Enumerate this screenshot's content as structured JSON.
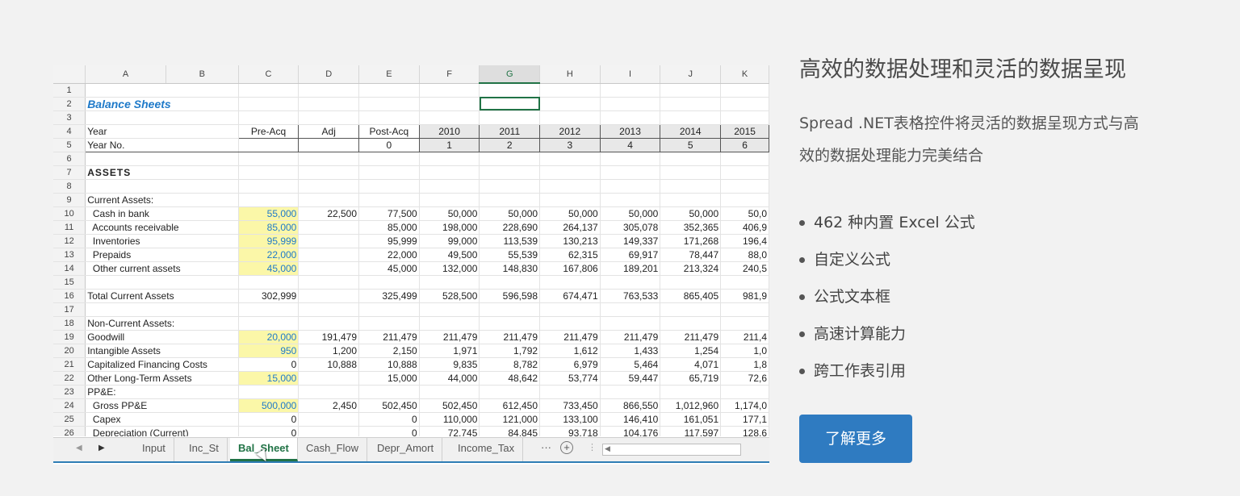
{
  "panel": {
    "title": "高效的数据处理和灵活的数据呈现",
    "description": "Spread .NET表格控件将灵活的数据呈现方式与高效的数据处理能力完美结合",
    "features": [
      "462 种内置 Excel 公式",
      "自定义公式",
      "公式文本框",
      "高速计算能力",
      "跨工作表引用"
    ],
    "button_label": "了解更多"
  },
  "sheet": {
    "columns": [
      "A",
      "B",
      "C",
      "D",
      "E",
      "F",
      "G",
      "H",
      "I",
      "J",
      "K"
    ],
    "selected_column": "G",
    "rows": [
      {
        "n": "1",
        "label": "",
        "c": "",
        "d": "",
        "e": "",
        "f": "",
        "g": "",
        "h": "",
        "i": "",
        "j": "",
        "k": ""
      },
      {
        "n": "2",
        "label": "Balance Sheets",
        "c": "",
        "d": "",
        "e": "",
        "f": "",
        "g": "",
        "h": "",
        "i": "",
        "j": "",
        "k": ""
      },
      {
        "n": "3",
        "label": "",
        "c": "",
        "d": "",
        "e": "",
        "f": "",
        "g": "",
        "h": "",
        "i": "",
        "j": "",
        "k": ""
      },
      {
        "n": "4",
        "label": "Year",
        "c": "Pre-Acq",
        "d": "Adj",
        "e": "Post-Acq",
        "f": "2010",
        "g": "2011",
        "h": "2012",
        "i": "2013",
        "j": "2014",
        "k": "2015"
      },
      {
        "n": "5",
        "label": "Year No.",
        "c": "",
        "d": "",
        "e": "0",
        "f": "1",
        "g": "2",
        "h": "3",
        "i": "4",
        "j": "5",
        "k": "6"
      },
      {
        "n": "6",
        "label": "",
        "c": "",
        "d": "",
        "e": "",
        "f": "",
        "g": "",
        "h": "",
        "i": "",
        "j": "",
        "k": ""
      },
      {
        "n": "7",
        "label": "ASSETS",
        "c": "",
        "d": "",
        "e": "",
        "f": "",
        "g": "",
        "h": "",
        "i": "",
        "j": "",
        "k": ""
      },
      {
        "n": "8",
        "label": "",
        "c": "",
        "d": "",
        "e": "",
        "f": "",
        "g": "",
        "h": "",
        "i": "",
        "j": "",
        "k": ""
      },
      {
        "n": "9",
        "label": "Current Assets:",
        "c": "",
        "d": "",
        "e": "",
        "f": "",
        "g": "",
        "h": "",
        "i": "",
        "j": "",
        "k": ""
      },
      {
        "n": "10",
        "label": "  Cash in bank",
        "c": "55,000",
        "d": "22,500",
        "e": "77,500",
        "f": "50,000",
        "g": "50,000",
        "h": "50,000",
        "i": "50,000",
        "j": "50,000",
        "k": "50,0"
      },
      {
        "n": "11",
        "label": "  Accounts receivable",
        "c": "85,000",
        "d": "",
        "e": "85,000",
        "f": "198,000",
        "g": "228,690",
        "h": "264,137",
        "i": "305,078",
        "j": "352,365",
        "k": "406,9"
      },
      {
        "n": "12",
        "label": "  Inventories",
        "c": "95,999",
        "d": "",
        "e": "95,999",
        "f": "99,000",
        "g": "113,539",
        "h": "130,213",
        "i": "149,337",
        "j": "171,268",
        "k": "196,4"
      },
      {
        "n": "13",
        "label": "  Prepaids",
        "c": "22,000",
        "d": "",
        "e": "22,000",
        "f": "49,500",
        "g": "55,539",
        "h": "62,315",
        "i": "69,917",
        "j": "78,447",
        "k": "88,0"
      },
      {
        "n": "14",
        "label": "  Other current assets",
        "c": "45,000",
        "d": "",
        "e": "45,000",
        "f": "132,000",
        "g": "148,830",
        "h": "167,806",
        "i": "189,201",
        "j": "213,324",
        "k": "240,5"
      },
      {
        "n": "15",
        "label": "",
        "c": "",
        "d": "",
        "e": "",
        "f": "",
        "g": "",
        "h": "",
        "i": "",
        "j": "",
        "k": ""
      },
      {
        "n": "16",
        "label": "Total Current Assets",
        "c": "302,999",
        "d": "",
        "e": "325,499",
        "f": "528,500",
        "g": "596,598",
        "h": "674,471",
        "i": "763,533",
        "j": "865,405",
        "k": "981,9"
      },
      {
        "n": "17",
        "label": "",
        "c": "",
        "d": "",
        "e": "",
        "f": "",
        "g": "",
        "h": "",
        "i": "",
        "j": "",
        "k": ""
      },
      {
        "n": "18",
        "label": "Non-Current Assets:",
        "c": "",
        "d": "",
        "e": "",
        "f": "",
        "g": "",
        "h": "",
        "i": "",
        "j": "",
        "k": ""
      },
      {
        "n": "19",
        "label": "Goodwill",
        "c": "20,000",
        "d": "191,479",
        "e": "211,479",
        "f": "211,479",
        "g": "211,479",
        "h": "211,479",
        "i": "211,479",
        "j": "211,479",
        "k": "211,4"
      },
      {
        "n": "20",
        "label": "Intangible Assets",
        "c": "950",
        "d": "1,200",
        "e": "2,150",
        "f": "1,971",
        "g": "1,792",
        "h": "1,612",
        "i": "1,433",
        "j": "1,254",
        "k": "1,0"
      },
      {
        "n": "21",
        "label": "Capitalized Financing Costs",
        "c": "0",
        "d": "10,888",
        "e": "10,888",
        "f": "9,835",
        "g": "8,782",
        "h": "6,979",
        "i": "5,464",
        "j": "4,071",
        "k": "1,8"
      },
      {
        "n": "22",
        "label": "Other Long-Term Assets",
        "c": "15,000",
        "d": "",
        "e": "15,000",
        "f": "44,000",
        "g": "48,642",
        "h": "53,774",
        "i": "59,447",
        "j": "65,719",
        "k": "72,6"
      },
      {
        "n": "23",
        "label": "PP&E:",
        "c": "",
        "d": "",
        "e": "",
        "f": "",
        "g": "",
        "h": "",
        "i": "",
        "j": "",
        "k": ""
      },
      {
        "n": "24",
        "label": "  Gross PP&E",
        "c": "500,000",
        "d": "2,450",
        "e": "502,450",
        "f": "502,450",
        "g": "612,450",
        "h": "733,450",
        "i": "866,550",
        "j": "1,012,960",
        "k": "1,174,0"
      },
      {
        "n": "25",
        "label": "  Capex",
        "c": "0",
        "d": "",
        "e": "0",
        "f": "110,000",
        "g": "121,000",
        "h": "133,100",
        "i": "146,410",
        "j": "161,051",
        "k": "177,1"
      },
      {
        "n": "26",
        "label": "  Depreciation (Current)",
        "c": "0",
        "d": "",
        "e": "0",
        "f": "72,745",
        "g": "84,845",
        "h": "93,718",
        "i": "104,176",
        "j": "117,597",
        "k": "128,6"
      }
    ],
    "highlighted_rows": [
      "10",
      "11",
      "12",
      "13",
      "14",
      "19",
      "20",
      "22",
      "24"
    ],
    "tabs": [
      "Input",
      "Inc_St",
      "Bal_Sheet",
      "Cash_Flow",
      "Depr_Amort",
      "Income_Tax"
    ],
    "active_tab": "Bal_Sheet",
    "more_label": "···"
  }
}
